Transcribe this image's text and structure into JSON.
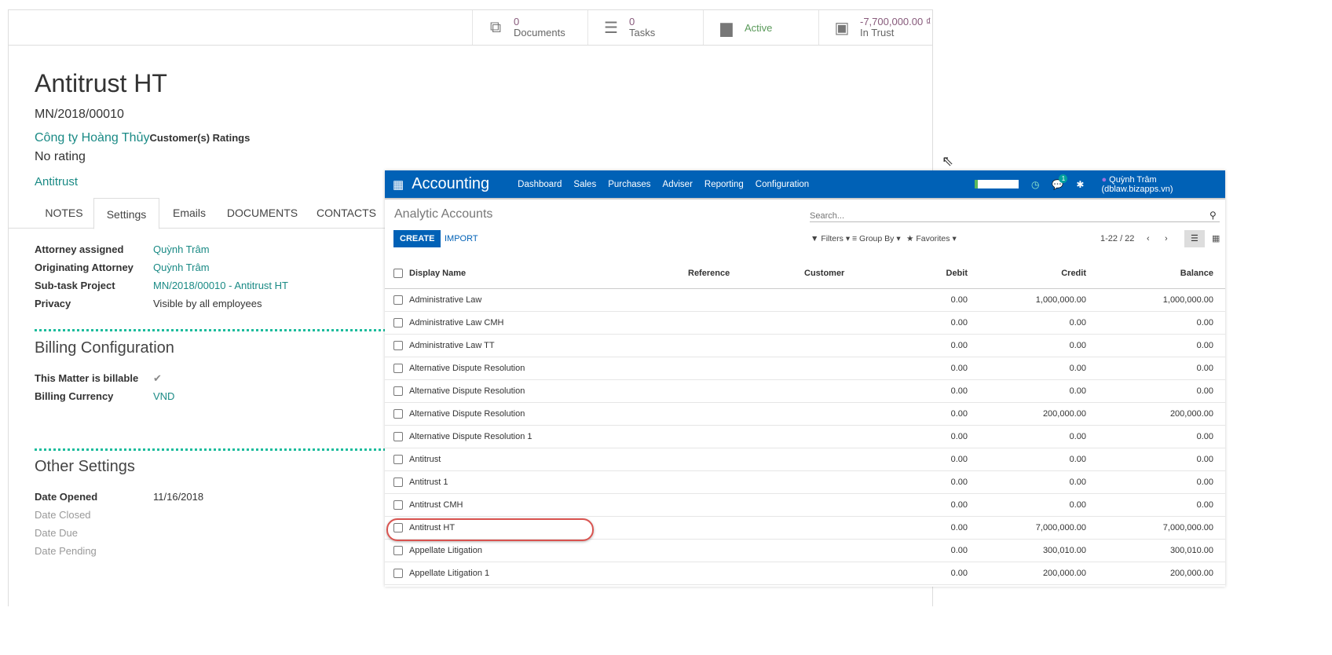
{
  "matter": {
    "stats": [
      {
        "num": "0",
        "label": "Documents",
        "icon": "documents-icon"
      },
      {
        "num": "0",
        "label": "Tasks",
        "icon": "tasks-icon"
      },
      {
        "num": "",
        "label": "Active",
        "icon": "archive-icon"
      },
      {
        "num": "-7,700,000.00 ₫",
        "label": "In Trust",
        "icon": "money-icon"
      }
    ],
    "title": "Antitrust HT",
    "reference": "MN/2018/00010",
    "customer": "Công ty Hoàng Thủy",
    "ratings_label": "Customer(s) Ratings",
    "rating": "No rating",
    "tag": "Antitrust",
    "tabs": [
      "NOTES",
      "Settings",
      "Emails",
      "DOCUMENTS",
      "CONTACTS"
    ],
    "fields": [
      {
        "label": "Attorney assigned",
        "value": "Quỳnh Trâm"
      },
      {
        "label": "Originating Attorney",
        "value": "Quỳnh Trâm"
      },
      {
        "label": "Sub-task Project",
        "value": "MN/2018/00010 - Antitrust HT"
      },
      {
        "label": "Privacy",
        "value": "Visible by all employees"
      }
    ],
    "billing": {
      "title": "Billing Configuration",
      "billable_label": "This Matter is billable",
      "billable_value": "✔",
      "currency_label": "Billing Currency",
      "currency_value": "VND"
    },
    "other": {
      "title": "Other Settings",
      "date_opened_label": "Date Opened",
      "date_opened": "11/16/2018",
      "date_closed_label": "Date Closed",
      "date_due_label": "Date Due",
      "date_pending_label": "Date Pending"
    }
  },
  "accounting": {
    "app": "Accounting",
    "menu": [
      "Dashboard",
      "Sales",
      "Purchases",
      "Adviser",
      "Reporting",
      "Configuration"
    ],
    "notif_count": "1",
    "user": "Quỳnh Trâm (dblaw.bizapps.vn)",
    "page_title": "Analytic Accounts",
    "search_placeholder": "Search...",
    "create": "CREATE",
    "import": "IMPORT",
    "filters": "Filters",
    "group_by": "Group By",
    "favorites": "Favorites",
    "pager": "1-22 / 22",
    "columns": [
      "Display Name",
      "Reference",
      "Customer",
      "Debit",
      "Credit",
      "Balance"
    ],
    "rows": [
      [
        "Administrative Law",
        "0.00",
        "1,000,000.00",
        "1,000,000.00"
      ],
      [
        "Administrative Law CMH",
        "0.00",
        "0.00",
        "0.00"
      ],
      [
        "Administrative Law TT",
        "0.00",
        "0.00",
        "0.00"
      ],
      [
        "Alternative Dispute Resolution",
        "0.00",
        "0.00",
        "0.00"
      ],
      [
        "Alternative Dispute Resolution",
        "0.00",
        "0.00",
        "0.00"
      ],
      [
        "Alternative Dispute Resolution",
        "0.00",
        "200,000.00",
        "200,000.00"
      ],
      [
        "Alternative Dispute Resolution 1",
        "0.00",
        "0.00",
        "0.00"
      ],
      [
        "Antitrust",
        "0.00",
        "0.00",
        "0.00"
      ],
      [
        "Antitrust 1",
        "0.00",
        "0.00",
        "0.00"
      ],
      [
        "Antitrust CMH",
        "0.00",
        "0.00",
        "0.00"
      ],
      [
        "Antitrust HT",
        "0.00",
        "7,000,000.00",
        "7,000,000.00"
      ],
      [
        "Appellate Litigation",
        "0.00",
        "300,010.00",
        "300,010.00"
      ],
      [
        "Appellate Litigation 1",
        "0.00",
        "200,000.00",
        "200,000.00"
      ]
    ]
  }
}
